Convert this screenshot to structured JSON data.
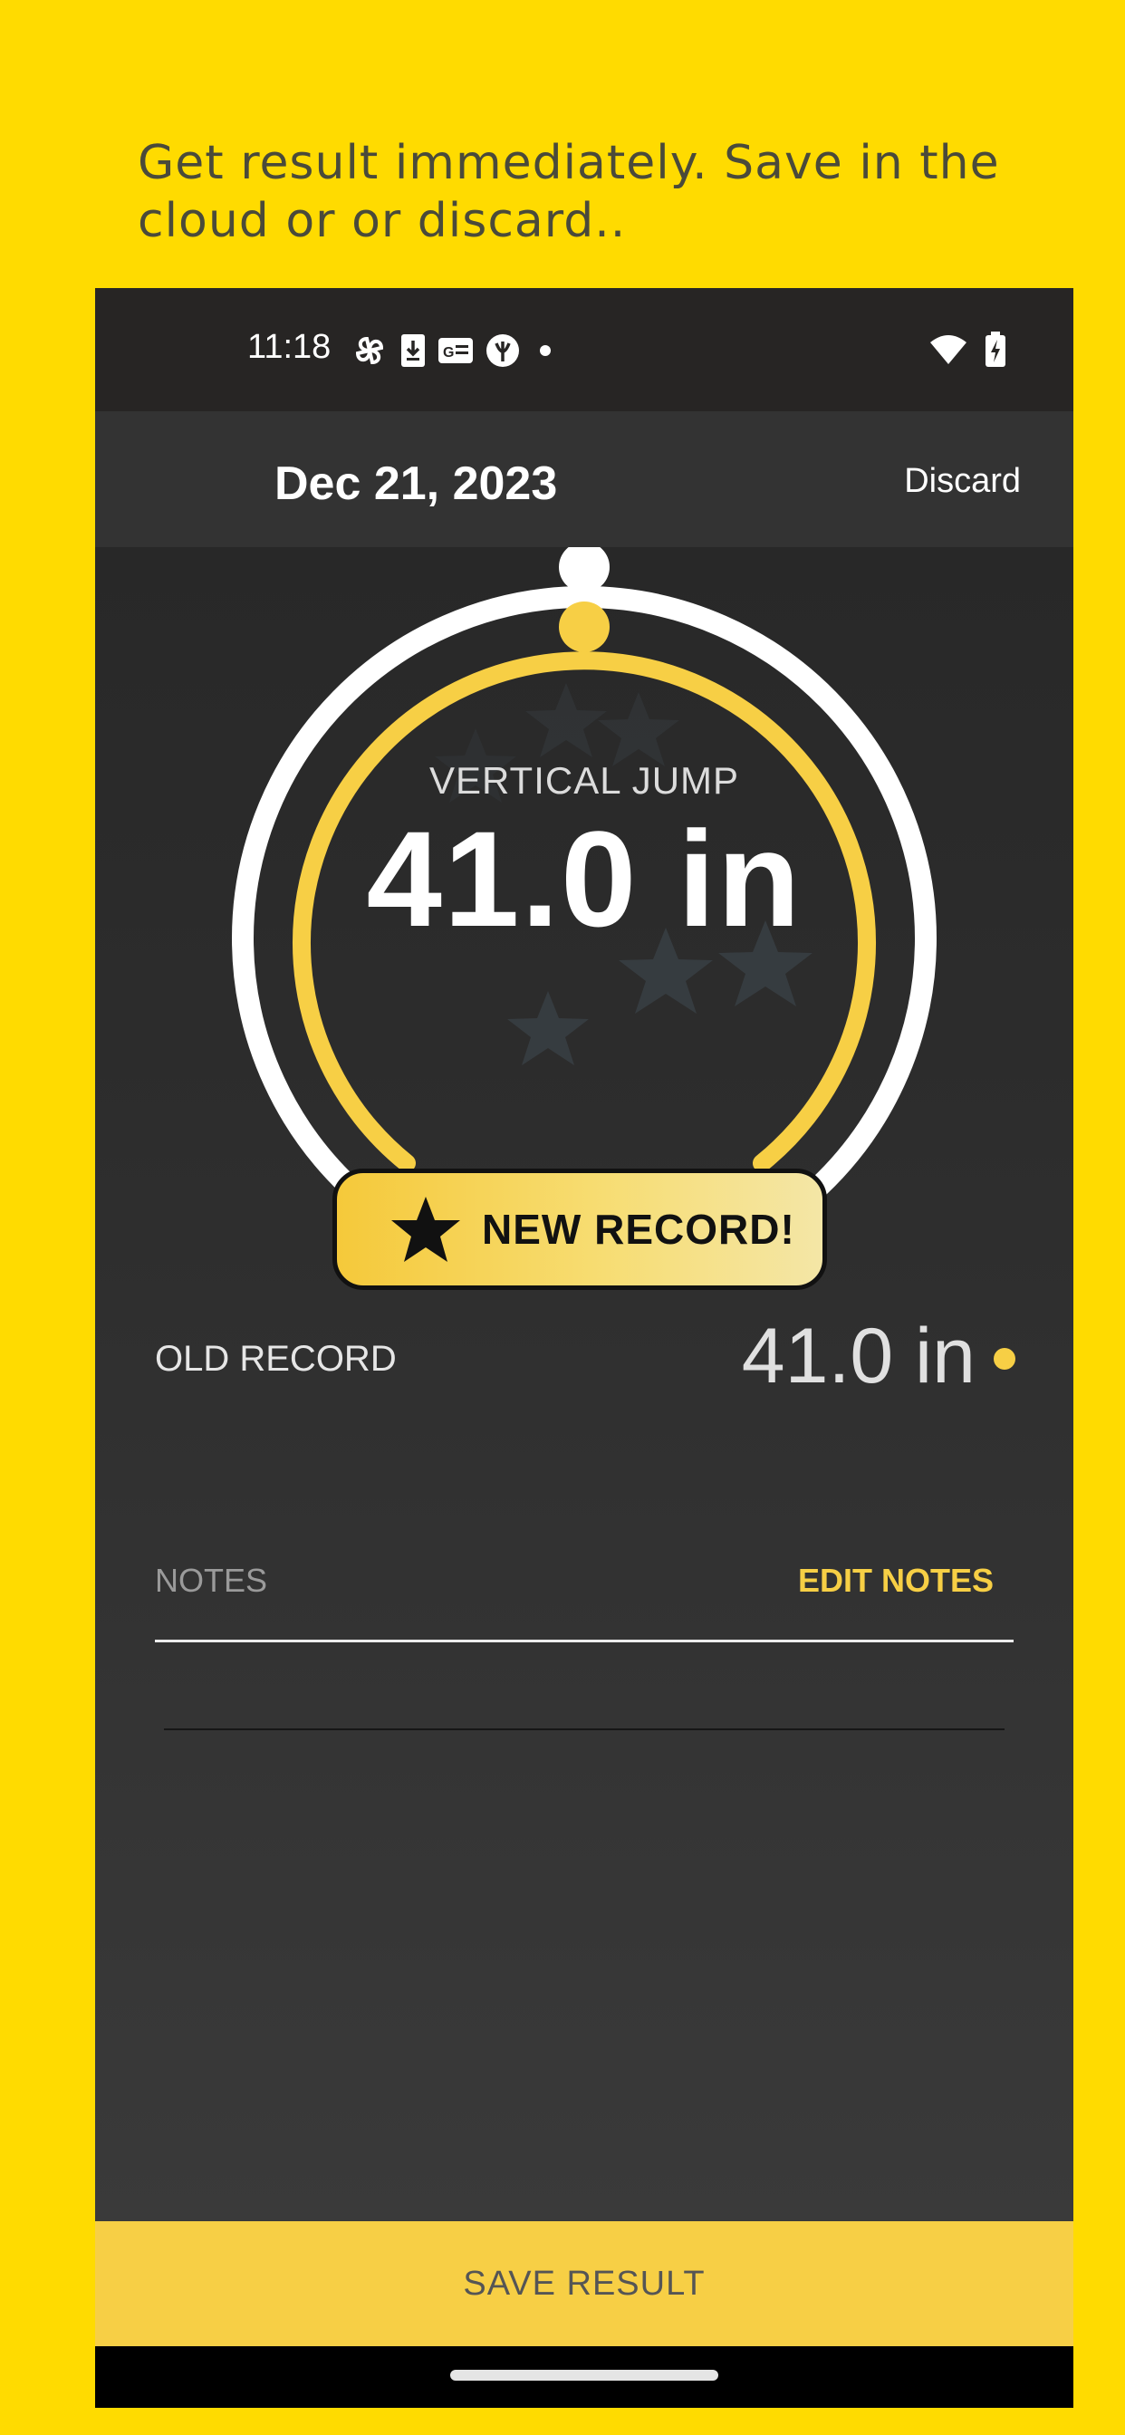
{
  "caption": "Get result immediately. Save in the cloud or or discard..",
  "status_bar": {
    "time": "11:18",
    "icons": [
      "pinwheel-icon",
      "download-icon",
      "news-icon",
      "shield-icon",
      "dot-icon"
    ],
    "right_icons": [
      "wifi-icon",
      "battery-charging-icon"
    ]
  },
  "header": {
    "date": "Dec 21, 2023",
    "discard_label": "Discard"
  },
  "result": {
    "metric_label": "VERTICAL JUMP",
    "value": "41.0 in",
    "badge_label": "NEW RECORD!"
  },
  "old_record": {
    "label": "OLD RECORD",
    "value": "41.0 in"
  },
  "notes": {
    "label": "NOTES",
    "edit_label": "EDIT NOTES"
  },
  "save_label": "SAVE RESULT",
  "colors": {
    "background": "#FFDB00",
    "accent": "#F7CF45",
    "screen": "#2d2d2d"
  }
}
